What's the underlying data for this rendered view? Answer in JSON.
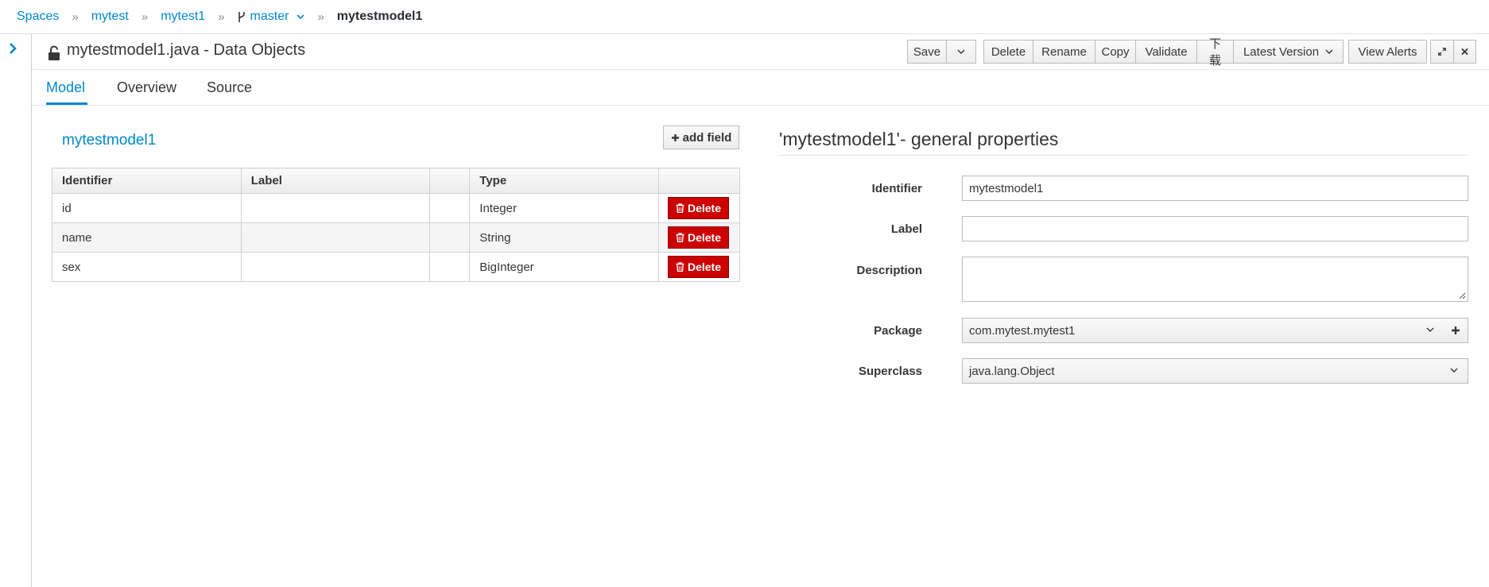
{
  "breadcrumb": {
    "items": [
      "Spaces",
      "mytest",
      "mytest1"
    ],
    "branch": "master",
    "current": "mytestmodel1"
  },
  "header": {
    "title": "mytestmodel1.java - Data Objects",
    "toolbar": {
      "save": "Save",
      "delete": "Delete",
      "rename": "Rename",
      "copy": "Copy",
      "validate": "Validate",
      "download": "下载",
      "latest_version": "Latest Version",
      "view_alerts": "View Alerts"
    }
  },
  "tabs": [
    "Model",
    "Overview",
    "Source"
  ],
  "model": {
    "name": "mytestmodel1",
    "add_field": "add field",
    "columns": [
      "Identifier",
      "Label",
      "",
      "Type",
      ""
    ],
    "delete_label": "Delete",
    "rows": [
      {
        "identifier": "id",
        "label": "",
        "type": "Integer"
      },
      {
        "identifier": "name",
        "label": "",
        "type": "String"
      },
      {
        "identifier": "sex",
        "label": "",
        "type": "BigInteger"
      }
    ]
  },
  "properties": {
    "title": "'mytestmodel1'- general properties",
    "identifier_label": "Identifier",
    "identifier_value": "mytestmodel1",
    "label_label": "Label",
    "label_value": "",
    "description_label": "Description",
    "description_value": "",
    "package_label": "Package",
    "package_value": "com.mytest.mytest1",
    "superclass_label": "Superclass",
    "superclass_value": "java.lang.Object"
  },
  "colors": {
    "link": "#0088ce",
    "danger": "#cc0000"
  }
}
